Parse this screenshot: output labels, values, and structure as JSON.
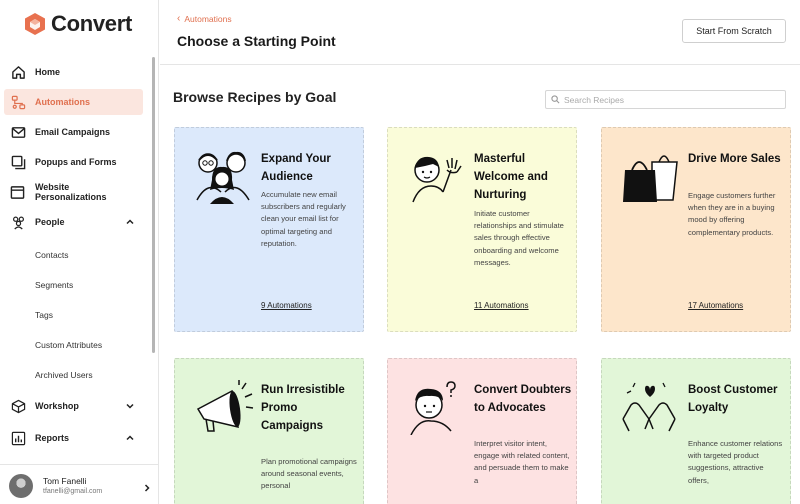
{
  "brand": {
    "name": "Convert",
    "color": "#e0704f"
  },
  "sidebar": {
    "items": [
      {
        "label": "Home",
        "icon": "home-icon"
      },
      {
        "label": "Automations",
        "icon": "automation-icon",
        "active": true
      },
      {
        "label": "Email Campaigns",
        "icon": "envelope-icon"
      },
      {
        "label": "Popups and Forms",
        "icon": "popup-icon"
      },
      {
        "label": "Website Personalizations",
        "icon": "browser-icon"
      },
      {
        "label": "People",
        "icon": "people-icon",
        "expanded": true
      },
      {
        "label": "Workshop",
        "icon": "cube-icon",
        "expanded": false
      },
      {
        "label": "Reports",
        "icon": "chart-icon",
        "expanded": true
      }
    ],
    "people_sub": [
      "Contacts",
      "Segments",
      "Tags",
      "Custom Attributes",
      "Archived Users"
    ]
  },
  "user": {
    "name": "Tom Fanelli",
    "email": "tfanelli@gmail.com"
  },
  "header": {
    "breadcrumb": "Automations",
    "title": "Choose a Starting Point",
    "scratch_button": "Start From Scratch"
  },
  "main": {
    "section_title": "Browse Recipes by Goal",
    "search_placeholder": "Search Recipes",
    "cards": [
      {
        "title": "Expand Your Audience",
        "description": "Accumulate new email subscribers and regularly clean your email list for optimal targeting and reputation.",
        "link": "9 Automations",
        "bg": "#dce9fb",
        "icon": "people-group-icon"
      },
      {
        "title": "Masterful Welcome and Nurturing",
        "description": "Initiate customer relationships and stimulate sales through effective onboarding and welcome messages.",
        "link": "11 Automations",
        "bg": "#fafcd9",
        "icon": "waving-person-icon"
      },
      {
        "title": "Drive More Sales",
        "description": "Engage customers further when they are in a buying mood by offering complementary products.",
        "link": "17 Automations",
        "bg": "#fde6cb",
        "icon": "shopping-bags-icon"
      },
      {
        "title": "Run Irresistible Promo Campaigns",
        "description": "Plan promotional campaigns around seasonal events, personal",
        "link": "",
        "bg": "#e2f6d8",
        "icon": "megaphone-icon"
      },
      {
        "title": "Convert Doubters to Advocates",
        "description": "Interpret visitor intent, engage with related content, and persuade them to make a",
        "link": "",
        "bg": "#fde2e2",
        "icon": "thinking-person-icon"
      },
      {
        "title": "Boost Customer Loyalty",
        "description": "Enhance customer relations with targeted product suggestions, attractive offers,",
        "link": "",
        "bg": "#e2f6d8",
        "icon": "heart-hands-icon"
      }
    ]
  }
}
